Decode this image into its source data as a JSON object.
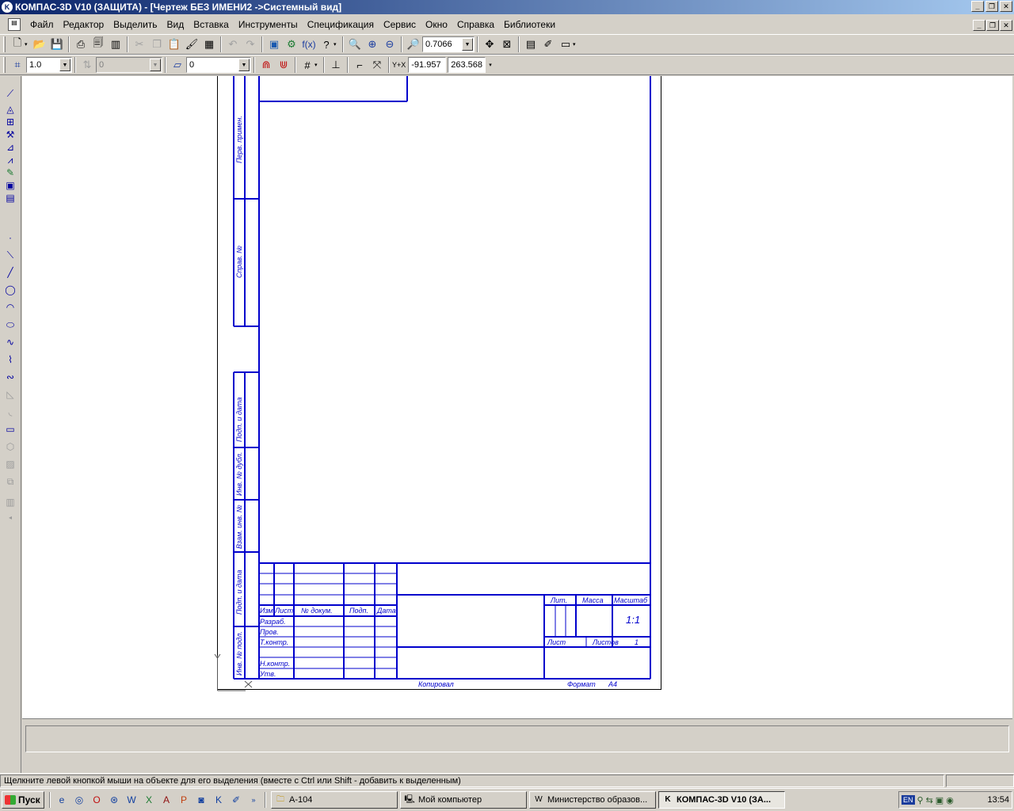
{
  "window": {
    "title": "КОМПАС-3D V10 (ЗАЩИТА) - [Чертеж БЕЗ ИМЕНИ2 ->Системный вид]",
    "controls": [
      "_",
      "❐",
      "✕"
    ]
  },
  "menu": [
    {
      "label": "Файл"
    },
    {
      "label": "Редактор"
    },
    {
      "label": "Выделить"
    },
    {
      "label": "Вид"
    },
    {
      "label": "Вставка"
    },
    {
      "label": "Инструменты"
    },
    {
      "label": "Спецификация"
    },
    {
      "label": "Сервис"
    },
    {
      "label": "Окно"
    },
    {
      "label": "Справка"
    },
    {
      "label": "Библиотеки"
    }
  ],
  "toolbar": {
    "zoom_value": "0.7066",
    "line_scale": "1.0",
    "layer_state": "0",
    "style_value": "0",
    "coord_x": "-91.957",
    "coord_y": "263.568",
    "coord_label": "Y+X"
  },
  "drawing": {
    "stamp": {
      "rows_left": [
        "Изм.",
        "Лист",
        "№ докум.",
        "Подп.",
        "Дата"
      ],
      "roles": [
        "Разраб.",
        "Пров.",
        "Т.контр.",
        "Н.контр.",
        "Утв."
      ],
      "lit": "Лит.",
      "mass": "Масса",
      "scale": "Масштаб",
      "scale_value": "1:1",
      "sheet": "Лист",
      "sheets": "Листов",
      "sheets_value": "1",
      "copied": "Копировал",
      "format": "Формат",
      "format_value": "A4"
    },
    "side_labels": [
      "Перв. примен.",
      "Справ. №",
      "Подп. и дата",
      "Инв. № дубл.",
      "Взам. инв. №",
      "Подп. и дата",
      "Инв. № подл."
    ]
  },
  "status": {
    "message": "Щелкните левой кнопкой мыши на объекте для его выделения (вместе с Ctrl или Shift - добавить к выделенным)"
  },
  "taskbar": {
    "start": "Пуск",
    "tasks": [
      {
        "label": "A-104",
        "active": false
      },
      {
        "label": "Мой компьютер",
        "active": false
      },
      {
        "label": "Министерство образов...",
        "active": false
      },
      {
        "label": "КОМПАС-3D V10 (ЗА...",
        "active": true
      }
    ],
    "lang": "EN",
    "clock": "13:54"
  }
}
